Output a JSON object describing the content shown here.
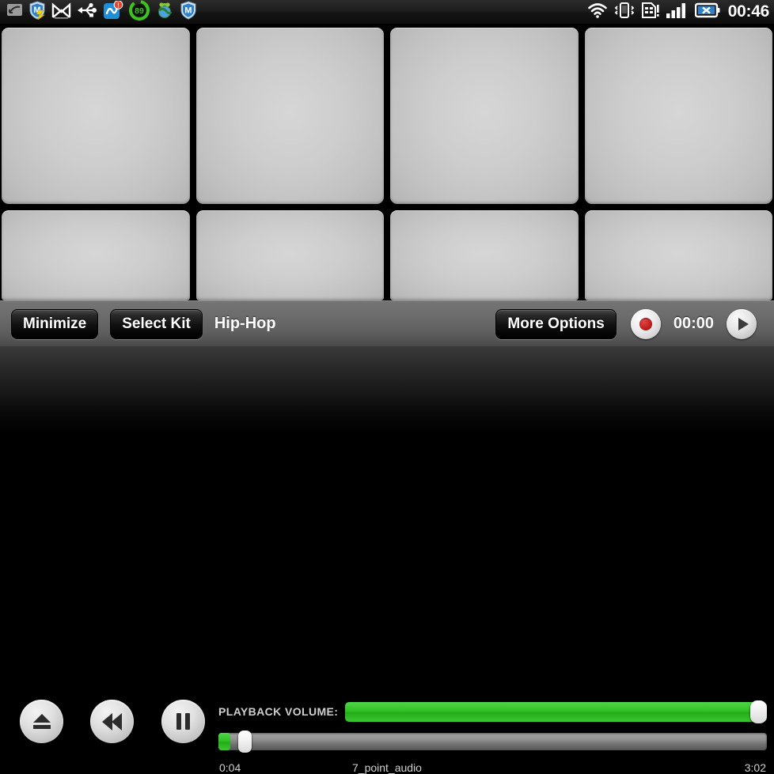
{
  "status_bar": {
    "clock": "00:46",
    "left_icons": [
      {
        "name": "missed-call-icon",
        "label": "missed call"
      },
      {
        "name": "mcafee-shield-lightning-icon",
        "label": "McAfee update"
      },
      {
        "name": "gmail-icon",
        "label": "Gmail"
      },
      {
        "name": "usb-icon",
        "label": "USB connected"
      },
      {
        "name": "sync-alert-icon",
        "label": "sync warning"
      },
      {
        "name": "battery-percent-gauge-icon",
        "label": "89"
      },
      {
        "name": "android-globe-icon",
        "label": "browser"
      },
      {
        "name": "mcafee-shield-icon",
        "label": "McAfee"
      }
    ],
    "right_icons": [
      {
        "name": "wifi-icon",
        "label": "Wi-Fi"
      },
      {
        "name": "vibrate-icon",
        "label": "vibrate"
      },
      {
        "name": "sim-alert-icon",
        "label": "SIM alert"
      },
      {
        "name": "signal-bars-icon",
        "label": "signal"
      },
      {
        "name": "battery-no-charge-icon",
        "label": "battery"
      }
    ],
    "gauge_value": "89"
  },
  "pads": {
    "row1": [
      {
        "id": "pad-1",
        "label": ""
      },
      {
        "id": "pad-2",
        "label": ""
      },
      {
        "id": "pad-3",
        "label": ""
      },
      {
        "id": "pad-4",
        "label": ""
      }
    ],
    "row2": [
      {
        "id": "pad-5",
        "label": ""
      },
      {
        "id": "pad-6",
        "label": ""
      },
      {
        "id": "pad-7",
        "label": ""
      },
      {
        "id": "pad-8",
        "label": ""
      }
    ]
  },
  "control_bar": {
    "minimize_label": "Minimize",
    "select_kit_label": "Select Kit",
    "kit_name": "Hip-Hop",
    "more_options_label": "More Options",
    "record_time": "00:00",
    "record_icon": "record-dot-icon",
    "play_icon": "play-triangle-icon"
  },
  "transport": {
    "eject_icon": "eject-icon",
    "rewind_icon": "rewind-icon",
    "pause_icon": "pause-icon",
    "volume_label": "PLAYBACK VOLUME:",
    "volume_percent": 100,
    "elapsed_time": "0:04",
    "track_title": "7_point_audio",
    "total_time": "3:02",
    "progress_percent": 2.2
  },
  "colors": {
    "accent_green": "#31c024",
    "pad_face": "#cdcdcd",
    "bar_gray": "#6d6d6d",
    "record_red": "#c21c1c"
  }
}
